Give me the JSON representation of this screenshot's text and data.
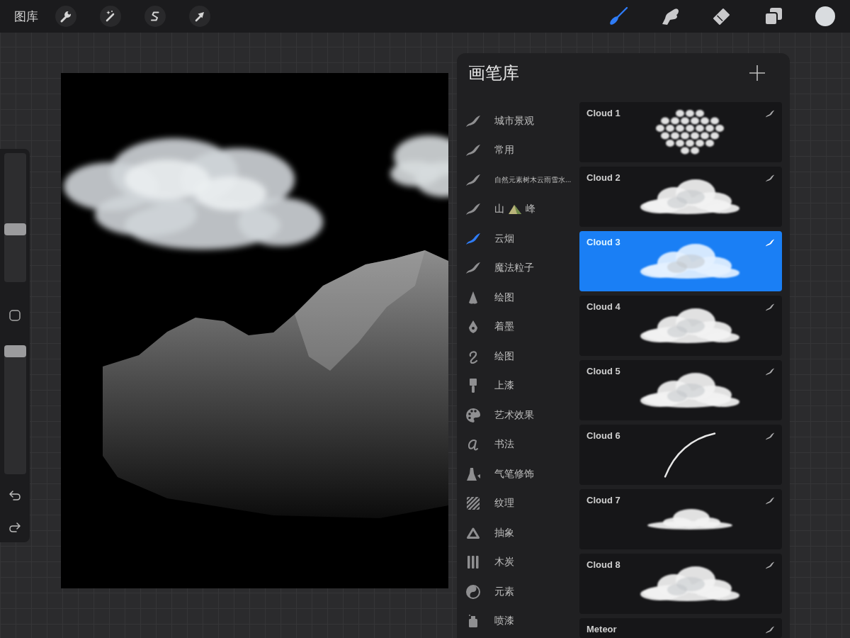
{
  "toolbar": {
    "gallery": "图库",
    "tools": [
      {
        "kind": "brush",
        "selected": true
      },
      {
        "kind": "smudge",
        "selected": false
      },
      {
        "kind": "eraser",
        "selected": false
      },
      {
        "kind": "layers",
        "selected": false
      }
    ],
    "color": "#d9dcdf"
  },
  "sidebar": {
    "size_slider": {
      "level": 0.4
    },
    "opacity_slider": {
      "level": 1
    }
  },
  "brush_library": {
    "title": "画笔库",
    "categories": [
      {
        "kind": "stroke",
        "label": "城市景观",
        "selected": false
      },
      {
        "kind": "stroke",
        "label": "常用",
        "selected": false
      },
      {
        "kind": "stroke",
        "label": "自然元素树木云雨雪水...",
        "selected": false
      },
      {
        "kind": "stroke",
        "label": "山",
        "label_after": "峰",
        "selected": false
      },
      {
        "kind": "stroke",
        "label": "云烟",
        "selected": true
      },
      {
        "kind": "stroke",
        "label": "魔法粒子",
        "selected": false
      },
      {
        "kind": "pencil",
        "label": "绘图",
        "selected": false
      },
      {
        "kind": "nib",
        "label": "着墨",
        "selected": false
      },
      {
        "kind": "squiggle",
        "label": "绘图",
        "selected": false
      },
      {
        "kind": "paintbrush",
        "label": "上漆",
        "selected": false
      },
      {
        "kind": "palette",
        "label": "艺术效果",
        "selected": false
      },
      {
        "kind": "script",
        "label": "书法",
        "selected": false
      },
      {
        "kind": "airbrush",
        "label": "气笔修饰",
        "selected": false
      },
      {
        "kind": "texture",
        "label": "纹理",
        "selected": false
      },
      {
        "kind": "triangle",
        "label": "抽象",
        "selected": false
      },
      {
        "kind": "bars",
        "label": "木炭",
        "selected": false
      },
      {
        "kind": "yinyang",
        "label": "元素",
        "selected": false
      },
      {
        "kind": "spray",
        "label": "喷漆",
        "selected": false
      }
    ],
    "brushes": [
      {
        "name": "Cloud 1",
        "kind": "puffs",
        "selected": false
      },
      {
        "name": "Cloud 2",
        "kind": "cloud",
        "selected": false
      },
      {
        "name": "Cloud 3",
        "kind": "cloud",
        "selected": true
      },
      {
        "name": "Cloud 4",
        "kind": "cloud",
        "selected": false
      },
      {
        "name": "Cloud 5",
        "kind": "cloud",
        "selected": false
      },
      {
        "name": "Cloud 6",
        "kind": "arc",
        "selected": false
      },
      {
        "name": "Cloud 7",
        "kind": "flat",
        "selected": false
      },
      {
        "name": "Cloud 8",
        "kind": "cloud",
        "selected": false
      },
      {
        "name": "Meteor",
        "kind": "hidden",
        "selected": false
      }
    ]
  }
}
